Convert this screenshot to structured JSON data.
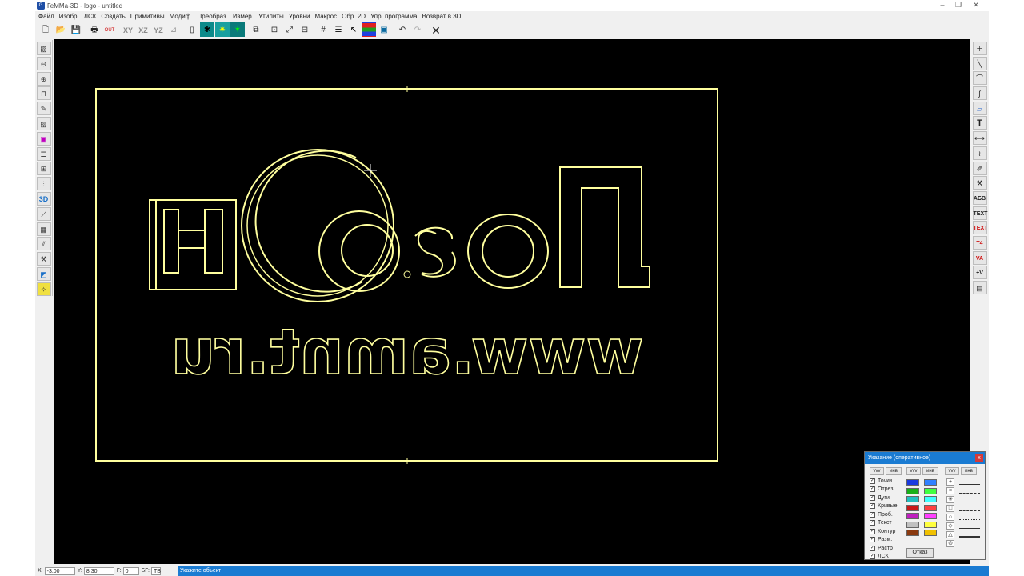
{
  "window": {
    "title": "ГеММа-3D - logo - untitled",
    "app_icon": "G"
  },
  "menu": [
    "Файл",
    "Изобр.",
    "ЛСК",
    "Создать",
    "Примитивы",
    "Модиф.",
    "Преобраз.",
    "Измер.",
    "Утилиты",
    "Уровни",
    "Макрос",
    "Обр. 2D",
    "Упр. программа",
    "Возврат в 3D"
  ],
  "toolbar": {
    "view_xy": "XY",
    "view_xz": "XZ",
    "view_yz": "YZ",
    "out_label": "OUT"
  },
  "left_tools": {
    "view3d": "3D"
  },
  "right_tools": {
    "abc": "АБВ",
    "text_bold": "TEXT",
    "text_red": "TEXT",
    "t4": "T4",
    "va": "VA",
    "plus_v": "+V"
  },
  "canvas_text": {
    "brand": "НОsoЛ",
    "website": "www.amnt.ru"
  },
  "status": {
    "x_label": "X:",
    "x_value": "-3.00",
    "y_label": "Y:",
    "y_value": "8.30",
    "g_label": "Г:",
    "g_value": "0",
    "bg_label": "БГ:",
    "tv_label": "ТВ",
    "prompt": "Укажите объект"
  },
  "panel": {
    "title": "Указание (оперативное)",
    "close": "x",
    "hdr_vvv": "vvv",
    "hdr_inv": "инв",
    "rows": [
      "Точки",
      "Отрез.",
      "Дуги",
      "Кривые",
      "Проб.",
      "Текст",
      "Контур",
      "Разм.",
      "Растр",
      "ЛСК"
    ],
    "cancel": "Отказ",
    "colors_left": [
      "#1a3be0",
      "#18b018",
      "#20c0c0",
      "#c81818",
      "#c020c0",
      "#c0c0c0",
      "#8a3a10"
    ],
    "colors_right": [
      "#3080ff",
      "#40ff40",
      "#40ffff",
      "#ff4040",
      "#ff40ff",
      "#ffff40",
      "#f0c000"
    ]
  },
  "colors": {
    "accent": "#1a7bd2",
    "canvas": "#000000",
    "geometry": "#ffff9e"
  }
}
